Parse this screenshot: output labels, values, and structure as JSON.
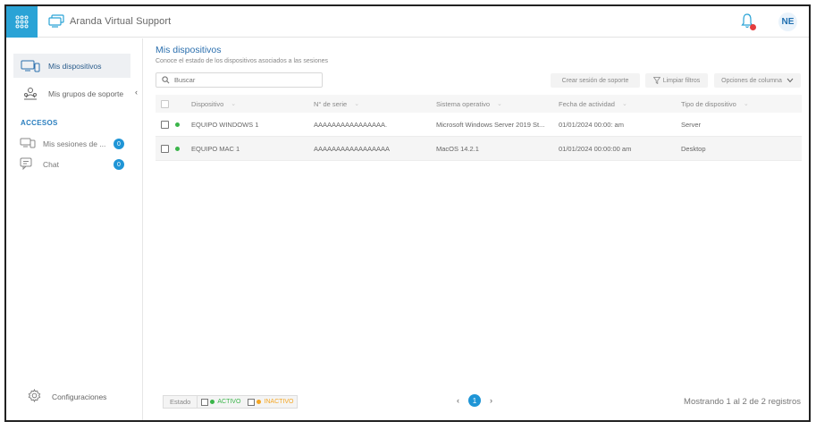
{
  "header": {
    "app_name": "Aranda Virtual Support",
    "avatar_initials": "NE",
    "accent_color": "#2aa3d6"
  },
  "sidebar": {
    "items": [
      {
        "label": "Mis dispositivos",
        "icon": "devices-icon",
        "active": true
      },
      {
        "label": "Mis grupos de soporte",
        "icon": "support-group-icon",
        "active": false
      }
    ],
    "section_label": "ACCESOS",
    "access": [
      {
        "label": "Mis sesiones de ...",
        "icon": "sessions-icon",
        "badge": "0"
      },
      {
        "label": "Chat",
        "icon": "chat-icon",
        "badge": "0"
      }
    ],
    "settings_label": "Configuraciones"
  },
  "main": {
    "title": "Mis dispositivos",
    "subtitle": "Conoce el estado de los dispositivos asociados a las sesiones",
    "search_placeholder": "Buscar",
    "buttons": {
      "create_session": "Crear sesión de soporte",
      "clear_filters": "Limpiar filtros",
      "column_options": "Opciones de columna"
    },
    "columns": [
      "Dispositivo",
      "N° de serie",
      "Sistema operativo",
      "Fecha de actividad",
      "Tipo de dispositivo"
    ],
    "rows": [
      {
        "device": "EQUIPO WINDOWS 1",
        "serial": "AAAAAAAAAAAAAAAA.",
        "os": "Microsoft Windows Server 2019 St...",
        "date": "01/01/2024 00:00: am",
        "type": "Server",
        "status_color": "#3bb54a"
      },
      {
        "device": "EQUIPO MAC 1",
        "serial": "AAAAAAAAAAAAAAAAA",
        "os": "MacOS 14.2.1",
        "date": "01/01/2024 00:00:00 am",
        "type": "Desktop",
        "status_color": "#3bb54a"
      }
    ]
  },
  "footer": {
    "status_label": "Estado",
    "active_label": "ACTIVO",
    "inactive_label": "INACTIVO",
    "active_color": "#3bb54a",
    "inactive_color": "#f5a623",
    "current_page": "1",
    "records_text": "Mostrando 1 al 2 de 2 registros"
  }
}
